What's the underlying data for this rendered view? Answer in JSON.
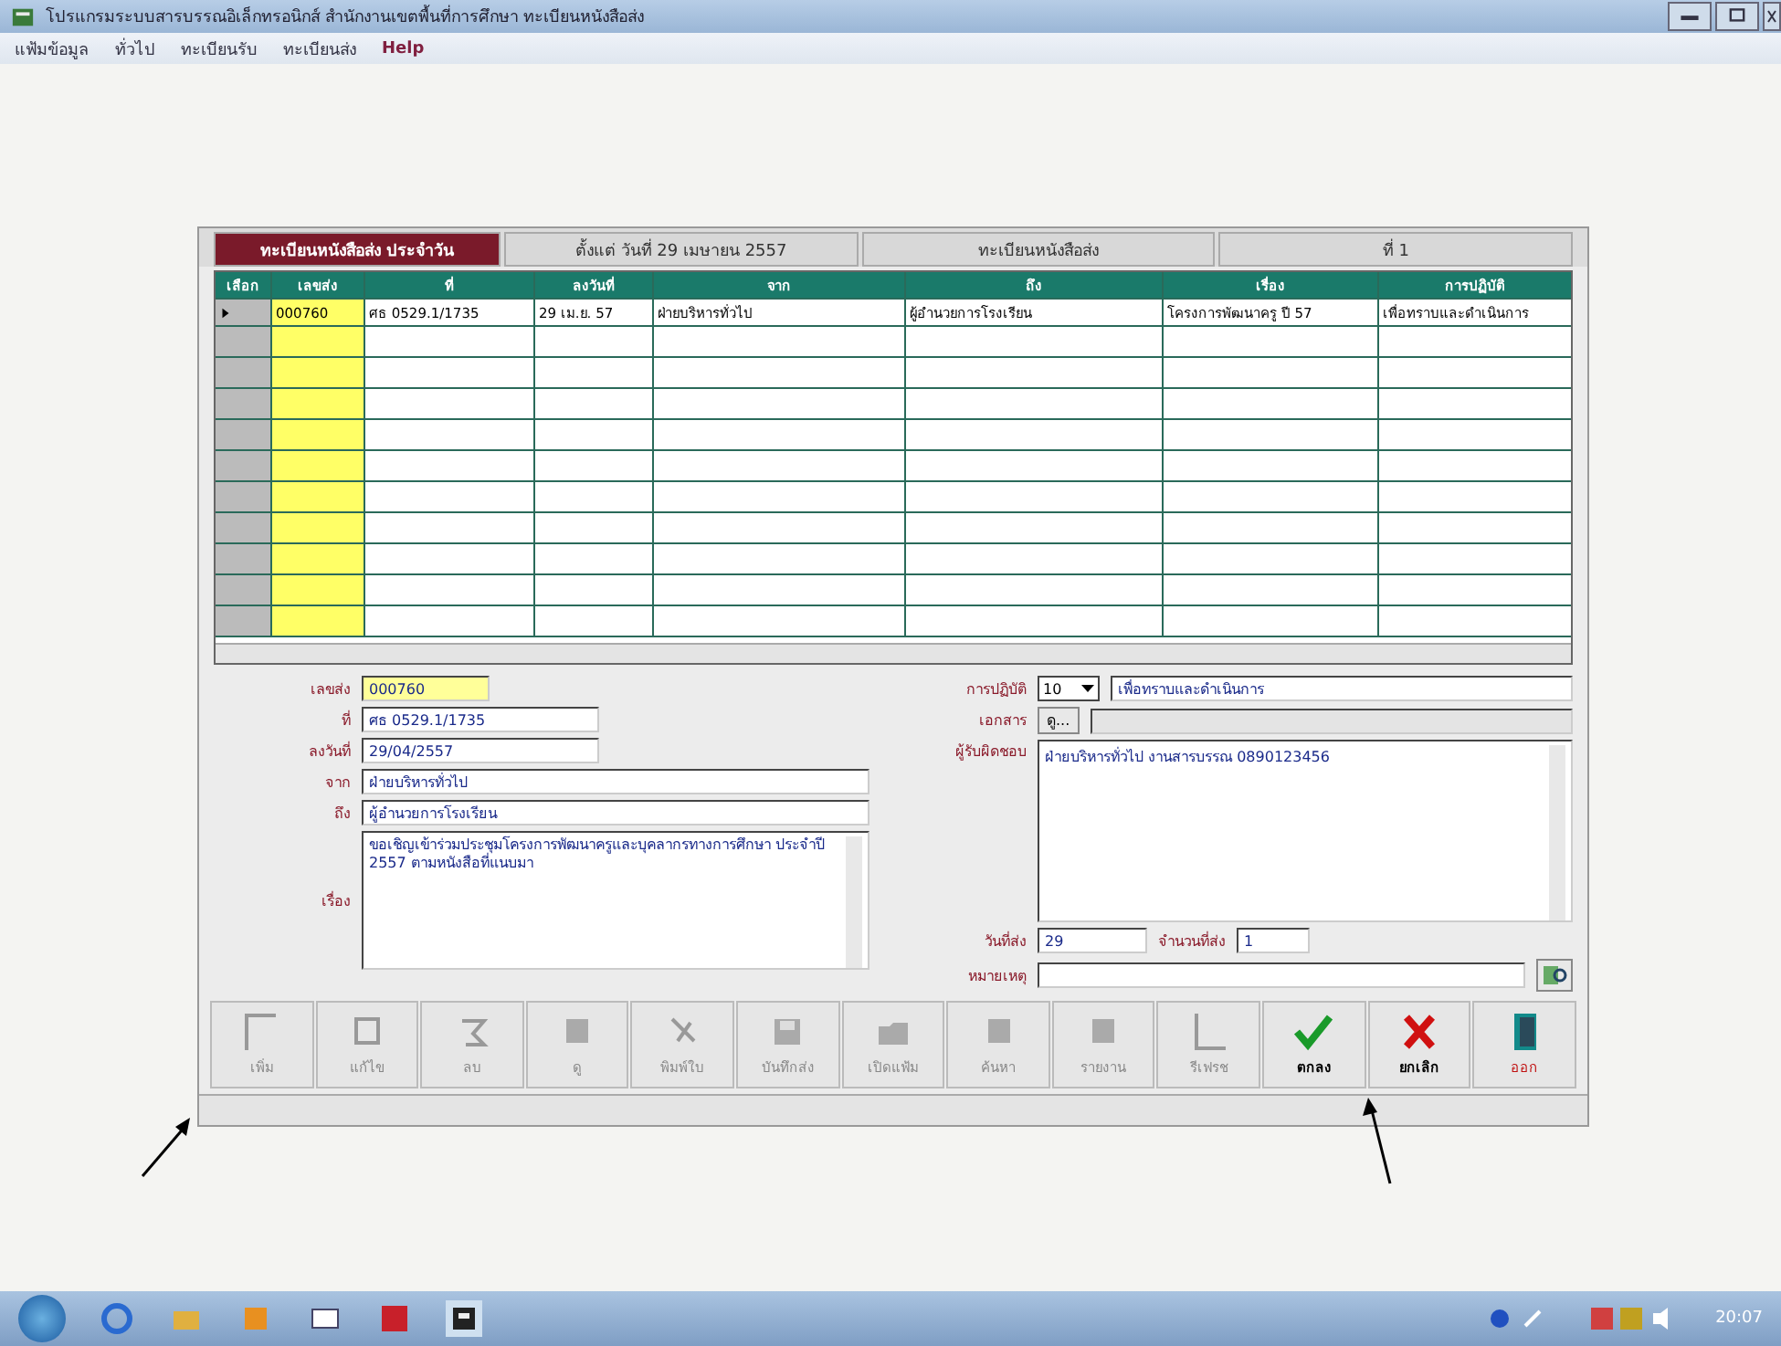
{
  "window": {
    "title": "โปรแกรมระบบสารบรรณอิเล็กทรอนิกส์ สำนักงานเขตพื้นที่การศึกษา ทะเบียนหนังสือส่ง"
  },
  "menu": [
    "แฟ้มข้อมูล",
    "ทั่วไป",
    "ทะเบียนรับ",
    "ทะเบียนส่ง",
    "Help"
  ],
  "header_tabs": [
    {
      "label": "ทะเบียนหนังสือส่ง ประจำวัน",
      "selected": true
    },
    {
      "label": "ตั้งแต่ วันที่ 29 เมษายน 2557",
      "selected": false
    },
    {
      "label": "ทะเบียนหนังสือส่ง",
      "selected": false
    },
    {
      "label": "ที่ 1",
      "selected": false
    }
  ],
  "table": {
    "columns": [
      "เลือก",
      "เลขส่ง",
      "ที่",
      "ลงวันที่",
      "จาก",
      "ถึง",
      "เรื่อง",
      "การปฏิบัติ"
    ],
    "rows": [
      {
        "selected": true,
        "cells": [
          "",
          "000760",
          "ศธ 0529.1/1735",
          "29 เม.ย. 57",
          "ฝ่ายบริหารทั่วไป",
          "ผู้อำนวยการโรงเรียน",
          "โครงการพัฒนาครู ปี 57",
          "เพื่อทราบและดำเนินการ"
        ]
      }
    ]
  },
  "form": {
    "left": [
      {
        "label": "เลขส่ง",
        "value": "000760",
        "kind": "short"
      },
      {
        "label": "ที่",
        "value": "ศธ 0529.1/1735",
        "kind": "medium"
      },
      {
        "label": "ลงวันที่",
        "value": "29/04/2557",
        "kind": "medium"
      },
      {
        "label": "จาก",
        "value": "ฝ่ายบริหารทั่วไป",
        "kind": "long"
      },
      {
        "label": "ถึง",
        "value": "ผู้อำนวยการโรงเรียน",
        "kind": "long"
      },
      {
        "label": "เรื่อง",
        "value": "ขอเชิญเข้าร่วมประชุมโครงการพัฒนาครูและบุคลากรทางการศึกษา ประจำปี 2557 ตามหนังสือที่แนบมา",
        "kind": "area"
      }
    ],
    "action_label": "การปฏิบัติ",
    "action_code": "10",
    "action_text": "เพื่อทราบและดำเนินการ",
    "document_label": "เอกสาร",
    "document_button": "ดู...",
    "responsible_label": "ผู้รับผิดชอบ",
    "responsible_text": "ฝ่ายบริหารทั่วไป งานสารบรรณ 0890123456",
    "sent_label": "วันที่ส่ง",
    "sent_value": "29",
    "count_label": "จำนวนที่ส่ง",
    "count_value": "1",
    "note_label": "หมายเหตุ"
  },
  "toolbar": [
    {
      "label": "เพิ่ม",
      "kind": "add",
      "disabled": true
    },
    {
      "label": "แก้ไข",
      "kind": "edit",
      "disabled": true
    },
    {
      "label": "ลบ",
      "kind": "delete",
      "disabled": true
    },
    {
      "label": "ดู",
      "kind": "block",
      "disabled": true
    },
    {
      "label": "พิมพ์ใบ",
      "kind": "print",
      "disabled": true
    },
    {
      "label": "บันทึกส่ง",
      "kind": "save",
      "disabled": true
    },
    {
      "label": "เปิดแฟ้ม",
      "kind": "folder",
      "disabled": true
    },
    {
      "label": "ค้นหา",
      "kind": "block",
      "disabled": true
    },
    {
      "label": "รายงาน",
      "kind": "block",
      "disabled": true
    },
    {
      "label": "รีเฟรช",
      "kind": "doc",
      "disabled": true
    },
    {
      "label": "ตกลง",
      "kind": "ok",
      "disabled": false
    },
    {
      "label": "ยกเลิก",
      "kind": "cancel",
      "disabled": false
    },
    {
      "label": "ออก",
      "kind": "exit",
      "disabled": false
    }
  ],
  "taskbar": {
    "time": "20:07"
  }
}
